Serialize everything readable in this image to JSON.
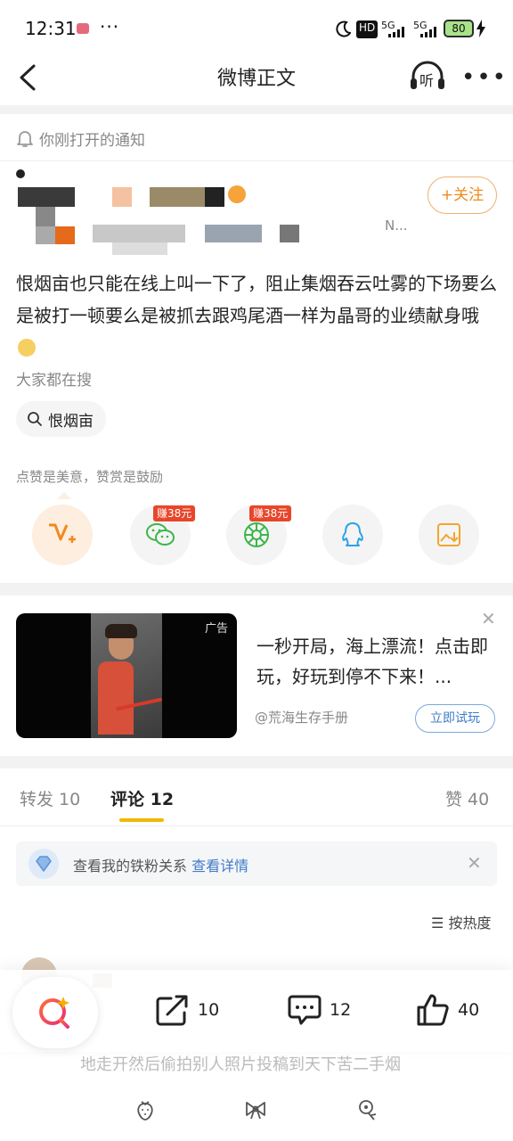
{
  "status_bar": {
    "time": "12:31",
    "more": "···",
    "network_hd": "HD",
    "network_a": "5G",
    "network_b": "5G",
    "battery": "80"
  },
  "header": {
    "title": "微博正文",
    "listen_label": "听"
  },
  "notification": {
    "text": "你刚打开的通知"
  },
  "author": {
    "follow_label": "+关注",
    "truncated": "N..."
  },
  "post": {
    "text": "恨烟亩也只能在线上叫一下了，阻止集烟吞云吐雾的下场要么是被打一顿要么是被抓去跟鸡尾酒一样为晶哥的业绩献身哦",
    "search_hint": "大家都在搜",
    "search_keyword": "恨烟亩"
  },
  "reward": {
    "hint": "点赞是美意，赞赏是鼓励",
    "earn_tags": [
      "赚38元",
      "赚38元"
    ]
  },
  "ad": {
    "label": "广告",
    "title": "一秒开局，海上漂流！点击即玩，好玩到停不下来！...",
    "source": "@荒海生存手册",
    "button": "立即试玩"
  },
  "tabs": {
    "repost": "转发 10",
    "comment": "评论 12",
    "like": "赞 40"
  },
  "fans": {
    "text": "查看我的铁粉关系",
    "link": "查看详情"
  },
  "sort": {
    "label": "按热度"
  },
  "comment_preview": {
    "text": "地走开然后偷拍别人照片投稿到天下苦二手烟"
  },
  "actions": {
    "repost_count": "10",
    "comment_count": "12",
    "like_count": "40"
  },
  "colors": {
    "accent_orange": "#f08a1c",
    "link_blue": "#3f7bc6",
    "tag_red": "#e8462a",
    "tab_yellow": "#f2b800"
  }
}
